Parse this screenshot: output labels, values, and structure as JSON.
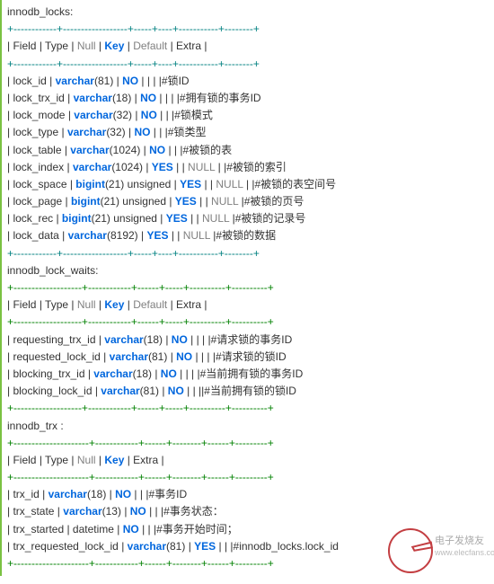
{
  "tables": [
    {
      "name": "innodb_locks:",
      "rule": "+------------+------------------+-----+----+-----------+--------+",
      "header": "| Field      | Type           | Null | Key | Default | Extra |",
      "rows": [
        {
          "field": "lock_id",
          "type": "varchar",
          "typearg": "(81)",
          "sp": "       ",
          "nul": "NO",
          "sp2": " |   |       |",
          "tail": "        |#锁ID"
        },
        {
          "field": "lock_trx_id",
          "type": "varchar",
          "typearg": "(18)",
          "sp": "    ",
          "nul": "NO",
          "sp2": "  |   |     |",
          "tail": "         |#拥有锁的事务ID"
        },
        {
          "field": "lock_mode",
          "type": "varchar",
          "typearg": "(32)",
          "sp": "     ",
          "nul": "NO",
          "sp2": "  |    |",
          "tail": "          |#锁模式"
        },
        {
          "field": "lock_type",
          "type": "varchar",
          "typearg": "(32)",
          "sp": "        ",
          "nul": "NO",
          "sp2": "   |    |",
          "tail": "       |#锁类型"
        },
        {
          "field": "lock_table",
          "type": "varchar",
          "typearg": "(1024)",
          "sp": "     ",
          "nul": "NO",
          "sp2": "    |    |",
          "tail": "         |#被锁的表"
        },
        {
          "field": "lock_index",
          "type": "varchar",
          "typearg": "(1024)",
          "sp": "    ",
          "nul": "YES",
          "sp2": "  |    |",
          "null_default": true,
          "tail": "    |        |#被锁的索引"
        },
        {
          "field": "lock_space",
          "type": "bigint",
          "typearg": "(21) unsigned",
          "sp": " ",
          "nul": "YES",
          "sp2": " |    |",
          "null_default": true,
          "tail": "    |    |#被锁的表空间号"
        },
        {
          "field": "lock_page",
          "type": "bigint",
          "typearg": "(21) unsigned",
          "sp": " ",
          "nul": "YES",
          "sp2": " |    |",
          "null_default": true,
          "tail": "        |#被锁的页号"
        },
        {
          "field": "lock_rec",
          "type": "bigint",
          "typearg": "(21) unsigned",
          "sp": " ",
          "nul": "YES",
          "sp2": " |    |",
          "null_default": true,
          "tail": "       |#被锁的记录号"
        },
        {
          "field": "lock_data",
          "type": "varchar",
          "typearg": "(8192)",
          "sp": "    ",
          "nul": "YES",
          "sp2": "  |   |",
          "null_default": true,
          "tail": "       |#被锁的数据"
        }
      ]
    },
    {
      "name": "innodb_lock_waits:",
      "rule": "+-------------------+------------+------+-----+----------+----------+",
      "header": "| Field | Type | Null | Key | Default | Extra |",
      "rows": [
        {
          "field": "requesting_trx_id",
          "type": "varchar",
          "typearg": "(18)",
          "sp": " ",
          "nul": "NO",
          "sp2": " | | |",
          "tail": " |#请求锁的事务ID"
        },
        {
          "field": "requested_lock_id",
          "type": "varchar",
          "typearg": "(81)",
          "sp": " ",
          "nul": "NO",
          "sp2": " | | |",
          "tail": " |#请求锁的锁ID"
        },
        {
          "field": "blocking_trx_id",
          "type": "varchar",
          "typearg": "(18)",
          "sp": " ",
          "nul": "NO",
          "sp2": " | | |",
          "tail": " |#当前拥有锁的事务ID"
        },
        {
          "field": "blocking_lock_id",
          "type": "varchar",
          "typearg": "(81)",
          "sp": " ",
          "nul": "NO",
          "sp2": " | | |",
          "tail": "|#当前拥有锁的锁ID"
        }
      ]
    },
    {
      "name": "innodb_trx :",
      "rule": "+---------------------+------------+------+--------+------+---------+",
      "header": "| Field | Type | Null | Key | Extra |",
      "rows": [
        {
          "field": "trx_id",
          "type": "varchar",
          "typearg": "(18)",
          "sp": " ",
          "nul": "NO",
          "sp2": " | |",
          "tail": " |#事务ID"
        },
        {
          "field": "trx_state",
          "type": "varchar",
          "typearg": "(13)",
          "sp": " ",
          "nul": "NO",
          "sp2": " | |",
          "tail": " |#事务状态："
        },
        {
          "raw": true,
          "text": "| trx_started | datetime | ",
          "nul": "NO",
          "sp2": " | |",
          "tail": " |#事务开始时间；"
        },
        {
          "field": "trx_requested_lock_id",
          "type": "varchar",
          "typearg": "(81)",
          "sp": " ",
          "nul": "YES",
          "sp2": " | |",
          "tail": " |#innodb_locks.lock_id"
        }
      ]
    }
  ],
  "watermark": {
    "line1": "电子发烧友",
    "line2": "www.elecfans.com"
  }
}
